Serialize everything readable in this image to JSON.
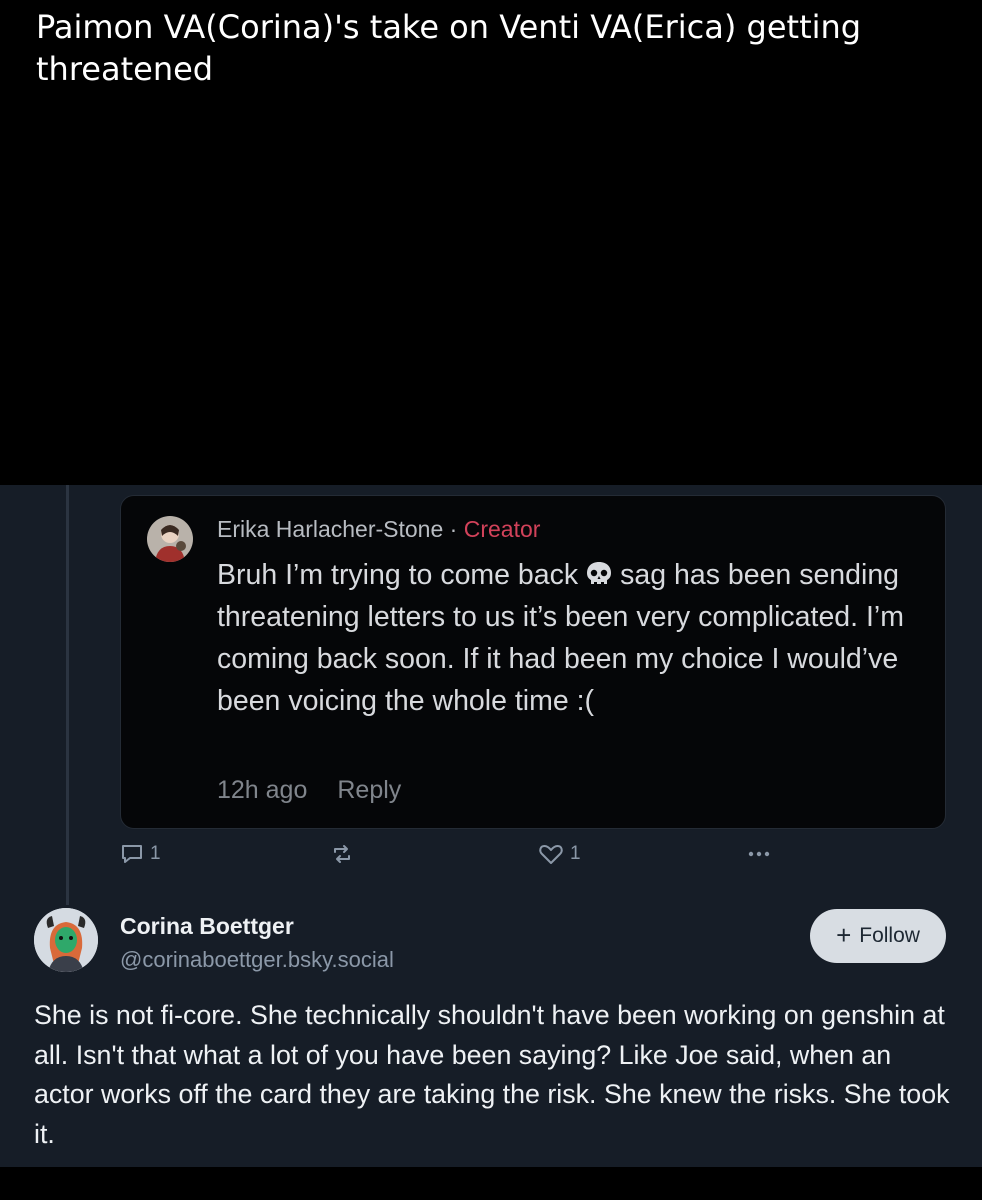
{
  "caption": "Paimon VA(Corina)'s take on Venti VA(Erica) getting threatened",
  "embed": {
    "author_name": "Erika Harlacher-Stone",
    "separator": " · ",
    "role_badge": "Creator",
    "text_part1": "Bruh I’m trying to come back",
    "text_part2": "sag has been sending threatening letters to us it’s been very complicated. I’m coming back soon. If it had been my choice I would’ve been voicing the whole time :(",
    "emoji_icon": "skull-emoji",
    "timestamp": "12h ago",
    "reply_label": "Reply"
  },
  "actions": {
    "reply_count": "1",
    "like_count": "1"
  },
  "post": {
    "author_name": "Corina Boettger",
    "handle": "@corinaboettger.bsky.social",
    "follow_label": "Follow",
    "text": "She is not fi-core. She technically shouldn't have been working on genshin at all. Isn't that what a lot of you have been saying? Like Joe said, when an actor works off the card they are taking the risk. She knew the risks. She took it."
  },
  "colors": {
    "background": "#000000",
    "panel": "#161d27",
    "embed_bg": "#050608",
    "creator_accent": "#d2425a",
    "muted": "#8b98a8",
    "follow_bg": "#d8dde3"
  }
}
